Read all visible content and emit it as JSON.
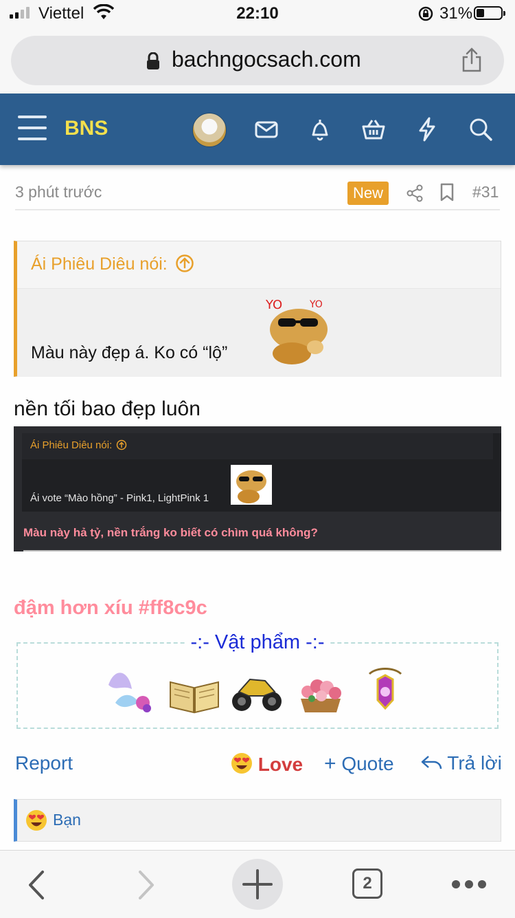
{
  "status_bar": {
    "carrier": "Viettel",
    "time": "22:10",
    "battery": "31%"
  },
  "browser": {
    "domain": "bachngocsach.com",
    "tab_count": "2"
  },
  "site": {
    "brand": "BNS",
    "brand_color": "#f4e04d",
    "header_color": "#2c5d8e"
  },
  "post": {
    "time_ago": "3 phút trước",
    "new_badge": "New",
    "post_number": "#31",
    "quote_author": "Ái Phiêu Diêu nói:",
    "quote_text": "Màu này đẹp á. Ko có “lộ”",
    "line1": "nền tối bao đẹp luôn",
    "embedded_quote_author": "Ái Phiêu Diêu nói:",
    "embedded_quote_text": "Ái vote “Mào hồng” - Pink1, LightPink 1",
    "embedded_reply": "Màu này hả tỷ, nền trắng ko biết có chìm quá không?",
    "pink_line": "đậm hơn xíu #ff8c9c",
    "items_title": "-:- Vật phẩm -:-",
    "items": [
      "fairy-wings",
      "open-book",
      "motorbike",
      "flower-basket",
      "amulet"
    ]
  },
  "actions": {
    "report": "Report",
    "love": "Love",
    "quote": "Quote",
    "reply": "Trả lời"
  },
  "reaction_bar": {
    "text": "Bạn"
  },
  "colors": {
    "accent_orange": "#e8a02b",
    "link_blue": "#2d6db5",
    "pink": "#ff8c9c"
  }
}
